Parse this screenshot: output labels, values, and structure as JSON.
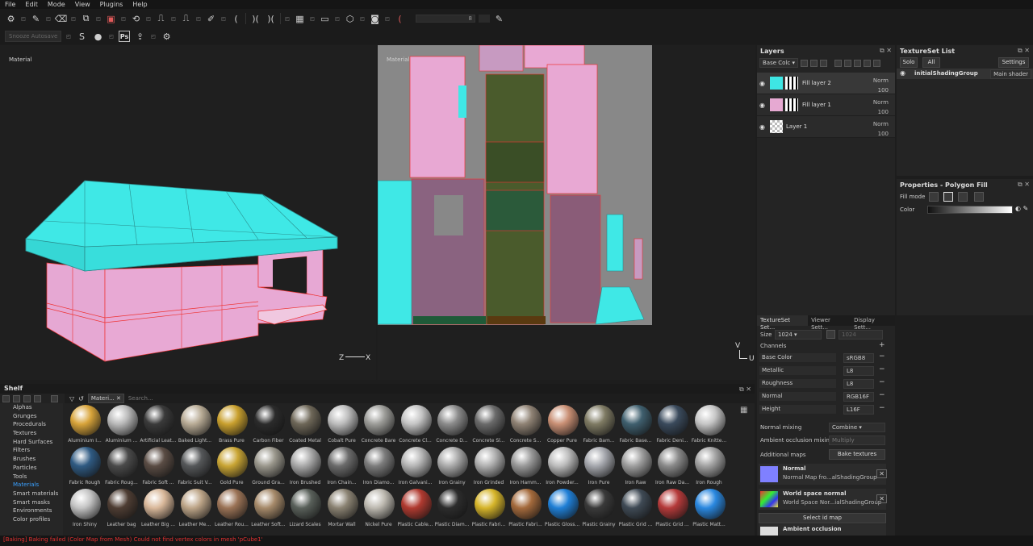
{
  "menu": [
    "File",
    "Edit",
    "Mode",
    "View",
    "Plugins",
    "Help"
  ],
  "toolbar": {
    "slider_value": "8",
    "snooze_label": "Snooze Autosave",
    "ps_label": "Ps"
  },
  "viewport3d": {
    "label": "Material",
    "axis_z": "Z",
    "axis_x": "X"
  },
  "viewport2d": {
    "label": "Material",
    "axis_v": "V",
    "axis_u": "U"
  },
  "shelf": {
    "title": "Shelf",
    "categories": [
      "Alphas",
      "Grunges",
      "Procedurals",
      "Textures",
      "Hard Surfaces",
      "Filters",
      "Brushes",
      "Particles",
      "Tools",
      "Materials",
      "Smart materials",
      "Smart masks",
      "Environments",
      "Color profiles"
    ],
    "active_category": "Materials",
    "filter_tag": "Materi...",
    "search_placeholder": "Search...",
    "materials": [
      {
        "label": "Aluminium I...",
        "color": "#d8a43a"
      },
      {
        "label": "Aluminium ...",
        "color": "#b9b9b9"
      },
      {
        "label": "Artificial Leat...",
        "color": "#3a3a3a"
      },
      {
        "label": "Baked Light...",
        "color": "#b8ab95"
      },
      {
        "label": "Brass Pure",
        "color": "#c9a02e"
      },
      {
        "label": "Carbon Fiber",
        "color": "#2b2b2b"
      },
      {
        "label": "Coated Metal",
        "color": "#6e6758"
      },
      {
        "label": "Cobalt Pure",
        "color": "#bcbcbc"
      },
      {
        "label": "Concrete Bare",
        "color": "#9c9c98"
      },
      {
        "label": "Concrete Cl...",
        "color": "#c4c4c4"
      },
      {
        "label": "Concrete D...",
        "color": "#8b8b8b"
      },
      {
        "label": "Concrete Sl...",
        "color": "#6a6a6a"
      },
      {
        "label": "Concrete S...",
        "color": "#8f8274"
      },
      {
        "label": "Copper Pure",
        "color": "#c98f74"
      },
      {
        "label": "Fabric Bam...",
        "color": "#7e7a63"
      },
      {
        "label": "Fabric Base...",
        "color": "#3f5f6e"
      },
      {
        "label": "Fabric Deni...",
        "color": "#3a4a5c"
      },
      {
        "label": "Fabric Knitte...",
        "color": "#c5c5c5"
      },
      {
        "label": "Fabric Rough",
        "color": "#2f5a82"
      },
      {
        "label": "Fabric Roug...",
        "color": "#4a4a4a"
      },
      {
        "label": "Fabric Soft ...",
        "color": "#5a4c44"
      },
      {
        "label": "Fabric Suit V...",
        "color": "#555759"
      },
      {
        "label": "Gold Pure",
        "color": "#c9a534"
      },
      {
        "label": "Ground Gra...",
        "color": "#9a978c"
      },
      {
        "label": "Iron Brushed",
        "color": "#a9a9a9"
      },
      {
        "label": "Iron Chain...",
        "color": "#6b6b6b"
      },
      {
        "label": "Iron Diamo...",
        "color": "#7c7c7c"
      },
      {
        "label": "Iron Galvani...",
        "color": "#b5b5b5"
      },
      {
        "label": "Iron Grainy",
        "color": "#aaaaaa"
      },
      {
        "label": "Iron Grinded",
        "color": "#b0b0b0"
      },
      {
        "label": "Iron Hamm...",
        "color": "#999999"
      },
      {
        "label": "Iron Powder...",
        "color": "#bcbcbc"
      },
      {
        "label": "Iron Pure",
        "color": "#a5a7ad"
      },
      {
        "label": "Iron Raw",
        "color": "#9e9e9e"
      },
      {
        "label": "Iron Raw Da...",
        "color": "#8a8a8a"
      },
      {
        "label": "Iron Rough",
        "color": "#a2a2a2"
      },
      {
        "label": "Iron Shiny",
        "color": "#c3c3c3"
      },
      {
        "label": "Leather bag",
        "color": "#4e3d33"
      },
      {
        "label": "Leather Big ...",
        "color": "#d9b89a"
      },
      {
        "label": "Leather Me...",
        "color": "#bda588"
      },
      {
        "label": "Leather Rou...",
        "color": "#9b7356"
      },
      {
        "label": "Leather Soft...",
        "color": "#a68a6a"
      },
      {
        "label": "Lizard Scales",
        "color": "#59605a"
      },
      {
        "label": "Mortar Wall",
        "color": "#8a8272"
      },
      {
        "label": "Nickel Pure",
        "color": "#bdb9b0"
      },
      {
        "label": "Plastic Cable...",
        "color": "#b03a30"
      },
      {
        "label": "Plastic Diam...",
        "color": "#2c2c2c"
      },
      {
        "label": "Plastic Fabri...",
        "color": "#d6b52a"
      },
      {
        "label": "Plastic Fabri...",
        "color": "#a46a3c"
      },
      {
        "label": "Plastic Gloss...",
        "color": "#1f7fd6"
      },
      {
        "label": "Plastic Grainy",
        "color": "#3a3a3a"
      },
      {
        "label": "Plastic Grid ...",
        "color": "#3f4a55"
      },
      {
        "label": "Plastic Grid ...",
        "color": "#b53a3a"
      },
      {
        "label": "Plastic Matt...",
        "color": "#2a88e0"
      }
    ]
  },
  "status": "[Baking] Baking failed (Color Map from Mesh) Could not find vertex colors in mesh 'pCube1'",
  "layers_panel": {
    "title": "Layers",
    "channel_select": "Base Colc",
    "layers": [
      {
        "name": "Fill layer 2",
        "blend": "Norm",
        "opacity": "100",
        "thumb_color": "#3ee6e4"
      },
      {
        "name": "Fill layer 1",
        "blend": "Norm",
        "opacity": "100",
        "thumb_color": "#e6a9d2"
      },
      {
        "name": "Layer 1",
        "blend": "Norm",
        "opacity": "100",
        "thumb_color": "checker"
      }
    ]
  },
  "textureset_list": {
    "title": "TextureSet List",
    "solo": "Solo",
    "all": "All",
    "settings": "Settings",
    "item": "initialShadingGroup",
    "shader": "Main shader"
  },
  "properties": {
    "title": "Properties - Polygon Fill",
    "fill_mode": "Fill mode",
    "color": "Color"
  },
  "textureset_settings": {
    "tabs": [
      "TextureSet Set...",
      "Viewer Sett...",
      "Display Sett..."
    ],
    "size_label": "Size",
    "size_value": "1024",
    "size_value2": "1024",
    "channels_label": "Channels",
    "channels": [
      {
        "name": "Base Color",
        "format": "sRGB8"
      },
      {
        "name": "Metallic",
        "format": "L8"
      },
      {
        "name": "Roughness",
        "format": "L8"
      },
      {
        "name": "Normal",
        "format": "RGB16F"
      },
      {
        "name": "Height",
        "format": "L16F"
      }
    ],
    "normal_mixing_label": "Normal mixing",
    "normal_mixing": "Combine",
    "ao_mixing_label": "Ambient occlusion mixing",
    "ao_mixing": "Multiply",
    "additional_maps": "Additional maps",
    "bake_textures": "Bake textures",
    "maps": [
      {
        "title": "Normal",
        "sub": "Normal Map fro...alShadingGroup",
        "color": "#7f80ff"
      },
      {
        "title": "World space normal",
        "sub": "World Space Nor...ialShadingGroup",
        "color": "multi"
      }
    ],
    "select_id_map": "Select id map",
    "ao_title": "Ambient occlusion"
  }
}
